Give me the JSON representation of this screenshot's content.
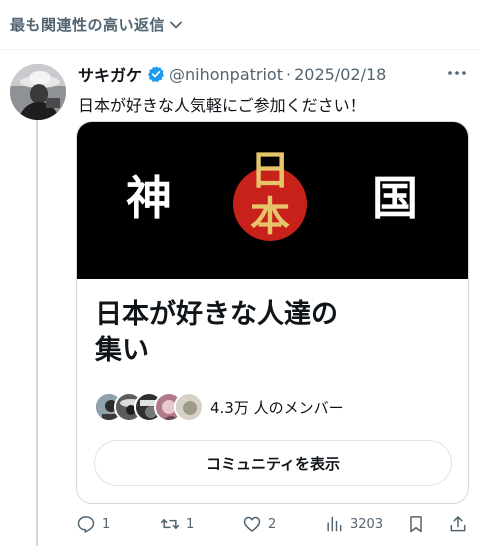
{
  "sort_bar": {
    "label": "最も関連性の高い返信"
  },
  "tweet": {
    "display_name": "サキガケ",
    "handle": "@nihonpatriot",
    "separator": "·",
    "date": "2025/02/18",
    "text": "日本が好きな人気軽にご参加ください！"
  },
  "community_card": {
    "banner_left": "神",
    "banner_right": "国",
    "banner_seal": [
      "日",
      "本"
    ],
    "title_lines": [
      "日本が好きな人達の",
      "集い"
    ],
    "members_text": "4.3万 人のメンバー",
    "join_button_label": "コミュニティを表示"
  },
  "actions": {
    "reply_count": "1",
    "repost_count": "1",
    "like_count": "2",
    "views_count": "3203"
  },
  "colors": {
    "text_primary": "#0f1419",
    "text_secondary": "#536471",
    "verified_blue": "#1d9bf0",
    "seal_red": "#c8201a",
    "seal_gold": "#e6c46a",
    "border": "#cfd9de"
  }
}
